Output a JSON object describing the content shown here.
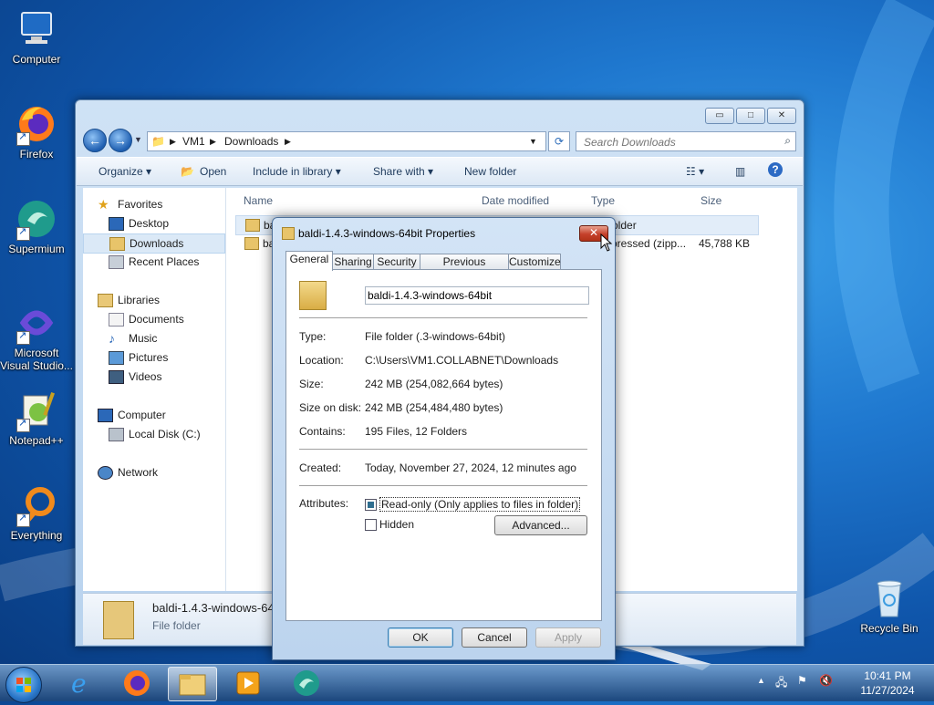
{
  "desktop": {
    "icons": [
      {
        "label": "Computer"
      },
      {
        "label": "Firefox"
      },
      {
        "label": "Supermium"
      },
      {
        "label": "Microsoft Visual Studio..."
      },
      {
        "label": "Notepad++"
      },
      {
        "label": "Everything"
      },
      {
        "label": "Recycle Bin"
      }
    ]
  },
  "explorer": {
    "caption_buttons": {
      "minimize": "▭",
      "maximize": "□",
      "close": "✕"
    },
    "breadcrumb": [
      "VM1",
      "Downloads"
    ],
    "search_placeholder": "Search Downloads",
    "toolbar": {
      "organize": "Organize ▾",
      "open": "Open",
      "include": "Include in library ▾",
      "share": "Share with ▾",
      "new_folder": "New folder"
    },
    "nav": {
      "favorites": "Favorites",
      "desktop": "Desktop",
      "downloads": "Downloads",
      "recent": "Recent Places",
      "libraries": "Libraries",
      "documents": "Documents",
      "music": "Music",
      "pictures": "Pictures",
      "videos": "Videos",
      "computer": "Computer",
      "local_disk": "Local Disk (C:)",
      "network": "Network"
    },
    "columns": {
      "name": "Name",
      "date": "Date modified",
      "type": "Type",
      "size": "Size"
    },
    "rows": [
      {
        "name": "ba",
        "type": "older",
        "size": ""
      },
      {
        "name": "ba",
        "type": "pressed (zipp...",
        "size": "45,788 KB"
      }
    ],
    "details": {
      "name": "baldi-1.4.3-windows-64",
      "type": "File folder"
    }
  },
  "dialog": {
    "title": "baldi-1.4.3-windows-64bit Properties",
    "tabs": [
      "General",
      "Sharing",
      "Security",
      "Previous Versions",
      "Customize"
    ],
    "folder_name": "baldi-1.4.3-windows-64bit",
    "labels": {
      "type": "Type:",
      "location": "Location:",
      "size": "Size:",
      "size_on_disk": "Size on disk:",
      "contains": "Contains:",
      "created": "Created:",
      "attributes": "Attributes:"
    },
    "values": {
      "type": "File folder (.3-windows-64bit)",
      "location": "C:\\Users\\VM1.COLLABNET\\Downloads",
      "size": "242 MB (254,082,664 bytes)",
      "size_on_disk": "242 MB (254,484,480 bytes)",
      "contains": "195 Files, 12 Folders",
      "created": "Today, November 27, 2024, 12 minutes ago"
    },
    "readonly_label": "Read-only (Only applies to files in folder)",
    "hidden_label": "Hidden",
    "advanced_label": "Advanced...",
    "ok_label": "OK",
    "cancel_label": "Cancel",
    "apply_label": "Apply",
    "close_glyph": "✕"
  },
  "taskbar": {
    "time": "10:41 PM",
    "date": "11/27/2024"
  }
}
